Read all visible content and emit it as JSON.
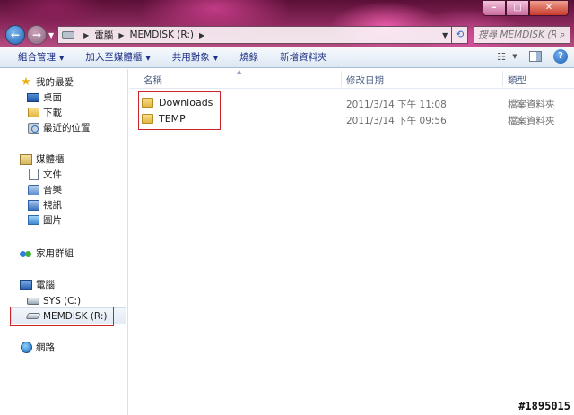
{
  "window": {
    "controls": {
      "minimize": "–",
      "maximize": "□",
      "close": "✕"
    }
  },
  "address_bar": {
    "crumbs": [
      "電腦",
      "MEMDISK (R:)"
    ],
    "search_placeholder": "搜尋 MEMDISK (R:)"
  },
  "command_bar": {
    "items": [
      "組合管理",
      "加入至媒體櫃",
      "共用對象",
      "燒錄",
      "新增資料夾"
    ]
  },
  "nav_pane": {
    "favorites": {
      "label": "我的最愛",
      "items": [
        "桌面",
        "下載",
        "最近的位置"
      ]
    },
    "libraries": {
      "label": "媒體櫃",
      "items": [
        "文件",
        "音樂",
        "視訊",
        "圖片"
      ]
    },
    "homegroup": {
      "label": "家用群組"
    },
    "computer": {
      "label": "電腦",
      "items": [
        "SYS (C:)",
        "MEMDISK (R:)"
      ]
    },
    "network": {
      "label": "網路"
    }
  },
  "columns": [
    "名稱",
    "修改日期",
    "類型"
  ],
  "files": [
    {
      "name": "Downloads",
      "modified": "2011/3/14 下午 11:08",
      "type": "檔案資料夾"
    },
    {
      "name": "TEMP",
      "modified": "2011/3/14 下午 09:56",
      "type": "檔案資料夾"
    }
  ],
  "watermark": "#1895015",
  "colors": {
    "highlight_box": "#c9252b",
    "link_text": "#1e3287",
    "title_bar": "#8e2a5e"
  }
}
